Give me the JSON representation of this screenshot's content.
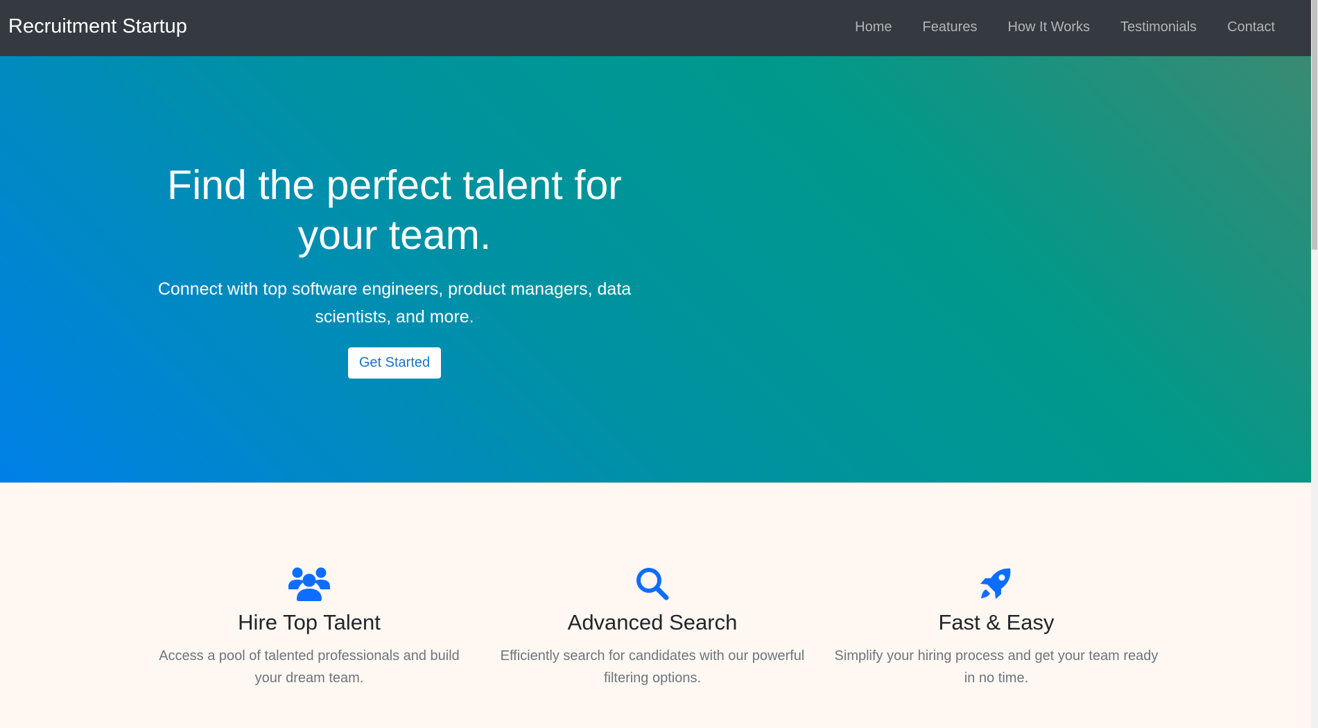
{
  "navbar": {
    "brand": "Recruitment Startup",
    "links": [
      {
        "label": "Home"
      },
      {
        "label": "Features"
      },
      {
        "label": "How It Works"
      },
      {
        "label": "Testimonials"
      },
      {
        "label": "Contact"
      }
    ]
  },
  "hero": {
    "title": "Find the perfect talent for your team.",
    "lead": "Connect with top software engineers, product managers, data scientists, and more.",
    "cta_label": "Get Started"
  },
  "features": [
    {
      "icon": "users-icon",
      "title": "Hire Top Talent",
      "text": "Access a pool of talented professionals and build your dream team."
    },
    {
      "icon": "search-icon",
      "title": "Advanced Search",
      "text": "Efficiently search for candidates with our powerful filtering options."
    },
    {
      "icon": "rocket-icon",
      "title": "Fast & Easy",
      "text": "Simplify your hiring process and get your team ready in no time."
    }
  ],
  "colors": {
    "navbar_bg": "#343a40",
    "accent": "#0d6efd",
    "hero_gradient_start": "#0080e8",
    "hero_gradient_end": "#3a8a72",
    "section_bg": "#fff7f2"
  }
}
